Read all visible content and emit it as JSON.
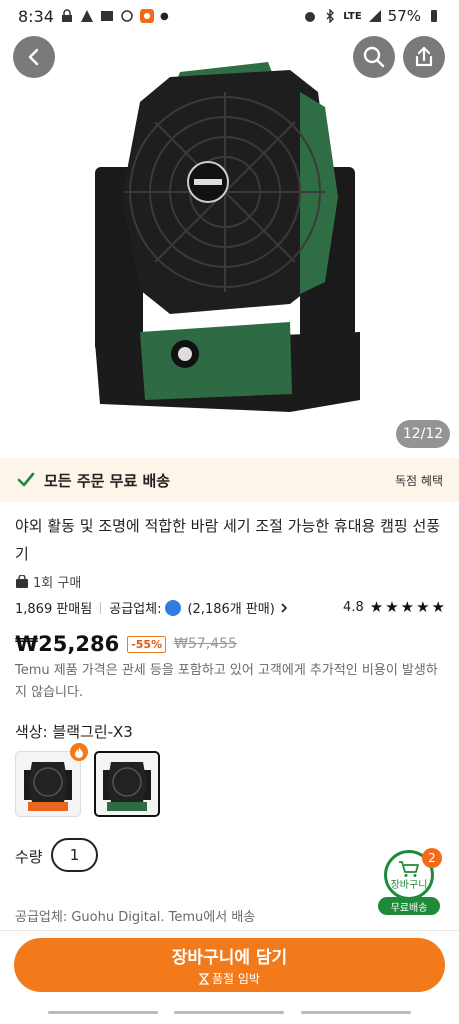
{
  "status_bar": {
    "time": "8:34",
    "network": "LTE",
    "battery": "57%"
  },
  "hero": {
    "page_counter": "12/12"
  },
  "shipping": {
    "text": "모든 주문 무료 배송",
    "right_label": "독점 혜택"
  },
  "product": {
    "title": "야외 활동 및 조명에 적합한 바람 세기 조절 가능한 휴대용 캠핑 선풍기",
    "bought": "1회 구매",
    "sold": "1,869 판매됨",
    "supplier_label": "공급업체:",
    "supplier_sales": "(2,186개 판매)",
    "rating": "4.8",
    "rating_stars": 5,
    "price": "₩25,286",
    "discount": "-55%",
    "original_price": "₩57,455",
    "price_note": "Temu 제품 가격은 관세 등을 포함하고 있어 고객에게 추가적인 비용이 발생하지 않습니다."
  },
  "options": {
    "color_label": "색상: 블랙그린-X3",
    "variants": [
      "orange-variant",
      "green-variant"
    ],
    "selected_index": 1
  },
  "quantity": {
    "label": "수량",
    "value": "1"
  },
  "cart": {
    "label": "장바구니",
    "count": "2",
    "free_shipping": "무료배송"
  },
  "supplier_line": "공급업체: Guohu Digital. Temu에서 배송",
  "cta": {
    "main": "장바구니에 담기",
    "sub": "품절 임박"
  },
  "colors": {
    "accent": "#f27a1a",
    "green": "#1f8a3a",
    "banner": "#fdf4ea"
  }
}
